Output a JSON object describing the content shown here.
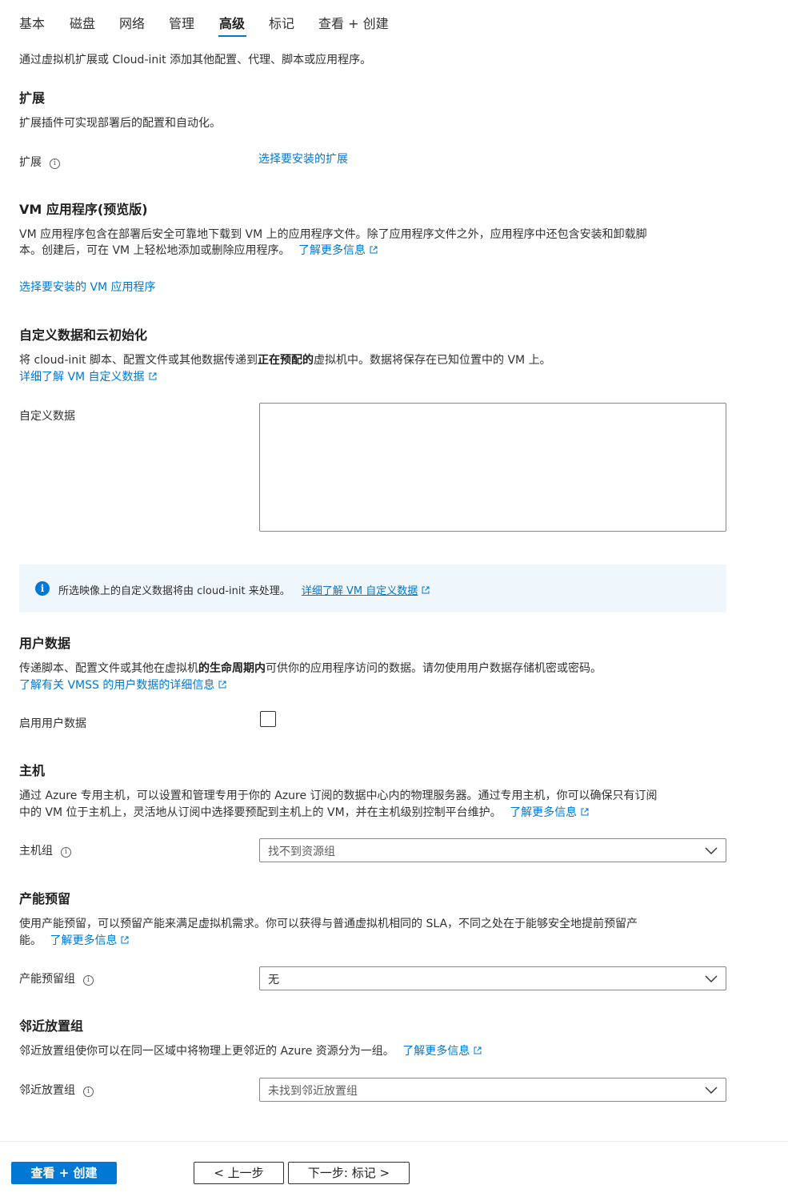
{
  "tabs": [
    "基本",
    "磁盘",
    "网络",
    "管理",
    "高级",
    "标记",
    "查看 + 创建"
  ],
  "active_tab": "高级",
  "intro": "通过虚拟机扩展或 Cloud-init 添加其他配置、代理、脚本或应用程序。",
  "extensions": {
    "title": "扩展",
    "desc": "扩展插件可实现部署后的配置和自动化。",
    "label": "扩展",
    "link": "选择要安装的扩展"
  },
  "vm_apps": {
    "title": "VM 应用程序(预览版)",
    "desc_line1": "VM 应用程序包含在部署后安全可靠地下载到 VM 上的应用程序文件。除了应用程序文件之外，应用程序中还包含安装和卸载脚",
    "desc_line2": "本。创建后，可在 VM 上轻松地添加或删除应用程序。",
    "learn_more": "了解更多信息",
    "select_link": "选择要安装的 VM 应用程序"
  },
  "custom_data": {
    "title": "自定义数据和云初始化",
    "desc_pre": "将 cloud-init 脚本、配置文件或其他数据传递到",
    "desc_bold": "正在预配的",
    "desc_post": "虚拟机中。数据将保存在已知位置中的 VM 上。",
    "learn_link": "详细了解 VM 自定义数据",
    "label": "自定义数据",
    "value": "",
    "info_text": "所选映像上的自定义数据将由 cloud-init 来处理。",
    "info_link": "详细了解 VM 自定义数据"
  },
  "user_data": {
    "title": "用户数据",
    "desc_pre": "传递脚本、配置文件或其他在虚拟机",
    "desc_bold": "的生命周期内",
    "desc_post": "可供你的应用程序访问的数据。请勿使用用户数据存储机密或密码。",
    "learn_link": "了解有关 VMSS 的用户数据的详细信息",
    "enable_label": "启用用户数据",
    "enabled": false
  },
  "host": {
    "title": "主机",
    "desc_line1": "通过 Azure 专用主机，可以设置和管理专用于你的 Azure 订阅的数据中心内的物理服务器。通过专用主机，你可以确保只有订阅",
    "desc_line2": "中的 VM 位于主机上，灵活地从订阅中选择要预配到主机上的 VM，并在主机级别控制平台维护。",
    "learn_more": "了解更多信息",
    "label": "主机组",
    "placeholder": "找不到资源组"
  },
  "capacity": {
    "title": "产能预留",
    "desc_line1": "使用产能预留，可以预留产能来满足虚拟机需求。你可以获得与普通虚拟机相同的 SLA，不同之处在于能够安全地提前预留产",
    "desc_line2": "能。",
    "learn_more": "了解更多信息",
    "label": "产能预留组",
    "value": "无"
  },
  "proximity": {
    "title": "邻近放置组",
    "desc": "邻近放置组使你可以在同一区域中将物理上更邻近的 Azure 资源分为一组。",
    "learn_more": "了解更多信息",
    "label": "邻近放置组",
    "placeholder": "未找到邻近放置组"
  },
  "footer": {
    "review_create": "查看 + 创建",
    "previous": "< 上一步",
    "next": "下一步: 标记 >"
  },
  "colors": {
    "accent": "#0078d4",
    "info_bg": "#eff6fc",
    "text": "#323130"
  },
  "icons": [
    "info-icon",
    "external-link-icon",
    "chevron-down-icon",
    "info-circle-icon"
  ]
}
